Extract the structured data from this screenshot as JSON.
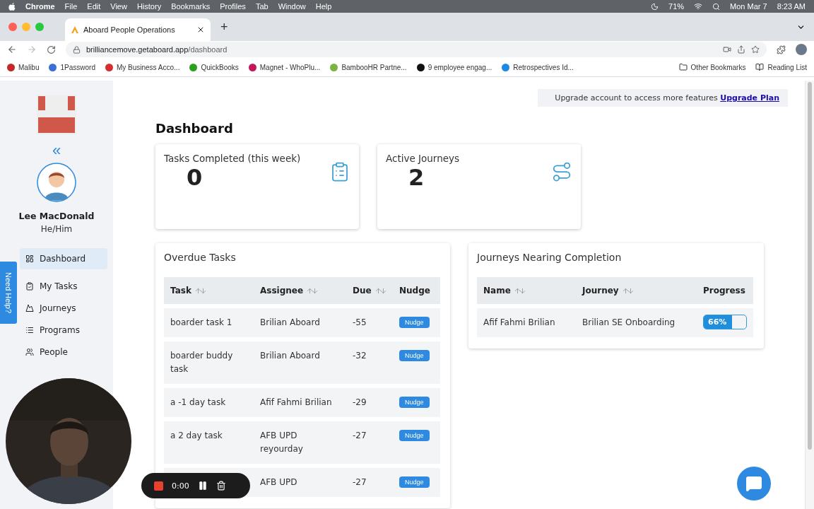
{
  "menu_bar": {
    "app": "Chrome",
    "menus": [
      "File",
      "Edit",
      "View",
      "History",
      "Bookmarks",
      "Profiles",
      "Tab",
      "Window",
      "Help"
    ],
    "battery": "71%",
    "date": "Mon Mar 7",
    "time": "8:23 AM"
  },
  "tab": {
    "title": "Aboard People Operations",
    "new_tab": "+"
  },
  "address_bar": {
    "host": "brilliancemove.getaboard.app",
    "path": "/dashboard"
  },
  "bookmarks": [
    {
      "label": "Malibu",
      "color": "#c62828"
    },
    {
      "label": "1Password",
      "color": "#3b6fd6"
    },
    {
      "label": "My Business Acco...",
      "color": "#d32f2f"
    },
    {
      "label": "QuickBooks",
      "color": "#2ca01c"
    },
    {
      "label": "Magnet - WhoPlu...",
      "color": "#c2185b"
    },
    {
      "label": "BambooHR Partne...",
      "color": "#7cb342"
    },
    {
      "label": "9 employee engag...",
      "color": "#111111"
    },
    {
      "label": "Retrospectives Id...",
      "color": "#1e88e5"
    }
  ],
  "bookmarks_right": [
    "Other Bookmarks",
    "Reading List"
  ],
  "sidebar": {
    "collapse": "«",
    "user_name": "Lee MacDonald",
    "pronouns": "He/Him",
    "items": [
      {
        "label": "Dashboard",
        "selected": true
      },
      {
        "label": "My Tasks",
        "selected": false
      },
      {
        "label": "Journeys",
        "selected": false
      },
      {
        "label": "Programs",
        "selected": false
      },
      {
        "label": "People",
        "selected": false
      }
    ]
  },
  "need_help": "Need Help?",
  "upgrade": {
    "text": "Upgrade account to access more features",
    "link": "Upgrade Plan"
  },
  "page_title": "Dashboard",
  "stats": [
    {
      "label": "Tasks Completed (this week)",
      "value": "0",
      "kind": "tasks"
    },
    {
      "label": "Active Journeys",
      "value": "2",
      "kind": "journeys"
    }
  ],
  "overdue_tasks": {
    "title": "Overdue Tasks",
    "columns": [
      {
        "label": "Task",
        "sortable": true
      },
      {
        "label": "Assignee",
        "sortable": true
      },
      {
        "label": "Due",
        "sortable": true
      },
      {
        "label": "Nudge",
        "sortable": false
      }
    ],
    "rows": [
      {
        "task": "boarder task 1",
        "assignee": "Brilian Aboard",
        "due": "-55",
        "action": "Nudge"
      },
      {
        "task": "boarder buddy task",
        "assignee": "Brilian Aboard",
        "due": "-32",
        "action": "Nudge"
      },
      {
        "task": "a -1 day task",
        "assignee": "Afif Fahmi Brilian",
        "due": "-29",
        "action": "Nudge"
      },
      {
        "task": "a 2 day task",
        "assignee": "AFB UPD reyourday",
        "due": "-27",
        "action": "Nudge"
      },
      {
        "assignee": "AFB UPD",
        "due": "-27",
        "action": "Nudge"
      }
    ]
  },
  "journeys_nearing": {
    "title": "Journeys Nearing Completion",
    "columns": [
      {
        "label": "Name",
        "sortable": true
      },
      {
        "label": "Journey",
        "sortable": true
      },
      {
        "label": "Progress",
        "sortable": false
      }
    ],
    "rows": [
      {
        "name": "Afif Fahmi Brilian",
        "journey": "Brilian SE Onboarding",
        "progress": "66%",
        "level": 0.66
      }
    ]
  },
  "recorder": {
    "time": "0:00"
  }
}
